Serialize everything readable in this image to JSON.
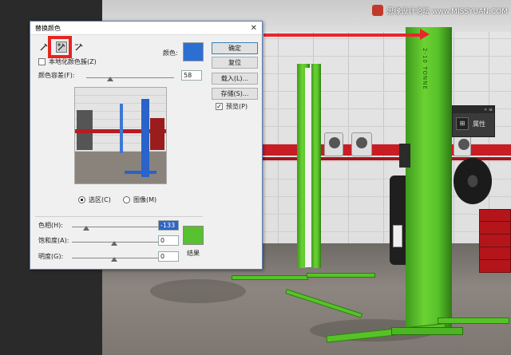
{
  "dialog": {
    "title": "替换颜色",
    "close_glyph": "✕",
    "localized_clusters_label": "本地化颜色簇(Z)",
    "color_label": "颜色:",
    "fuzziness_label": "颜色容差(F):",
    "fuzziness_value": "58",
    "buttons": {
      "ok": "确定",
      "reset": "复位",
      "load": "载入(L)...",
      "save": "存储(S)...",
      "preview": "预览(P)"
    },
    "view_options": [
      {
        "label": "选区(C)",
        "selected": true
      },
      {
        "label": "图像(M)",
        "selected": false
      }
    ],
    "replacement": {
      "hue_label": "色相(H):",
      "hue_value": "-133",
      "saturation_label": "饱和度(A):",
      "saturation_value": "0",
      "lightness_label": "明度(G):",
      "lightness_value": "0",
      "result_label": "结果"
    },
    "preview_checked": true,
    "localized_checked": false,
    "colors": {
      "selected_color": "#2c6fd1",
      "result_color": "#58c12f",
      "highlight_red": "#e52521"
    },
    "tools": [
      "eyedropper-icon",
      "eyedropper-plus-icon",
      "eyedropper-minus-icon"
    ]
  },
  "properties_panel": {
    "label": "属性",
    "collapse_glyph": "»",
    "menu_glyph": "≡"
  },
  "watermark": {
    "text": "思缘设计论坛 www.MISSYUAN.COM"
  },
  "photo_post_text": "2-10 TONNE"
}
